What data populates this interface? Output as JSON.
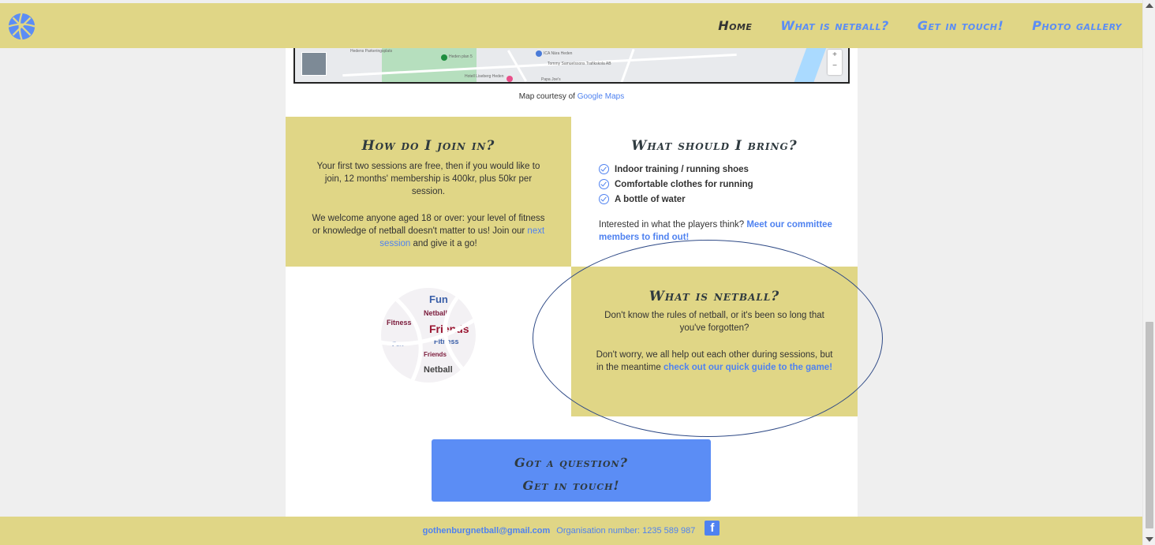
{
  "nav": {
    "links": [
      {
        "label": "Home"
      },
      {
        "label": "What is netball?"
      },
      {
        "label": "Get in touch!"
      },
      {
        "label": "Photo gallery"
      }
    ]
  },
  "map": {
    "caption_prefix": "Map courtesy of ",
    "caption_link": "Google Maps",
    "labels": [
      "Hedens Parkeringsplats",
      "Heden plan 5",
      "ICA Nära Heden",
      "Hotell Liseberg Heden",
      "Tommy Samuelssons Trafikskola AB",
      "Papa Joe's"
    ]
  },
  "join": {
    "title": "How do I join in?",
    "para1": "Your first two sessions are free, then if you would like to join, 12 months' membership is 400kr, plus 50kr per session.",
    "para2_before": "We welcome anyone aged 18 or over: your level of fitness or knowledge of netball doesn't matter to us! Join our ",
    "para2_link": "next session",
    "para2_after": " and give it a go!"
  },
  "bring": {
    "title": "What should I bring?",
    "items": [
      "Indoor training / running shoes",
      "Comfortable clothes for running",
      "A bottle of water"
    ],
    "text_before": "Interested in what the players think? ",
    "text_link": "Meet our committee members to find out!"
  },
  "what": {
    "title": "What is netball?",
    "para1": "Don't know the rules of netball, or it's been so long that you've forgotten?",
    "para2_before": "Don't worry, we all help out each other during sessions, but in the meantime ",
    "para2_link": "check out our quick guide to the game!"
  },
  "ball": {
    "words": [
      "Fun",
      "Netball",
      "Fitness",
      "Friends",
      "Fun",
      "Fitness",
      "Friends",
      "Netball"
    ]
  },
  "cta": {
    "line1": "Got a question?",
    "line2": "Get in touch!"
  },
  "footer": {
    "email": "gothenburgnetball@gmail.com",
    "org": "Organisation number: 1235 589 987",
    "fb_glyph": "f"
  },
  "colors": {
    "yellow": "#e0d686",
    "blue": "#5b8df5",
    "dark": "#2f3a3f"
  }
}
